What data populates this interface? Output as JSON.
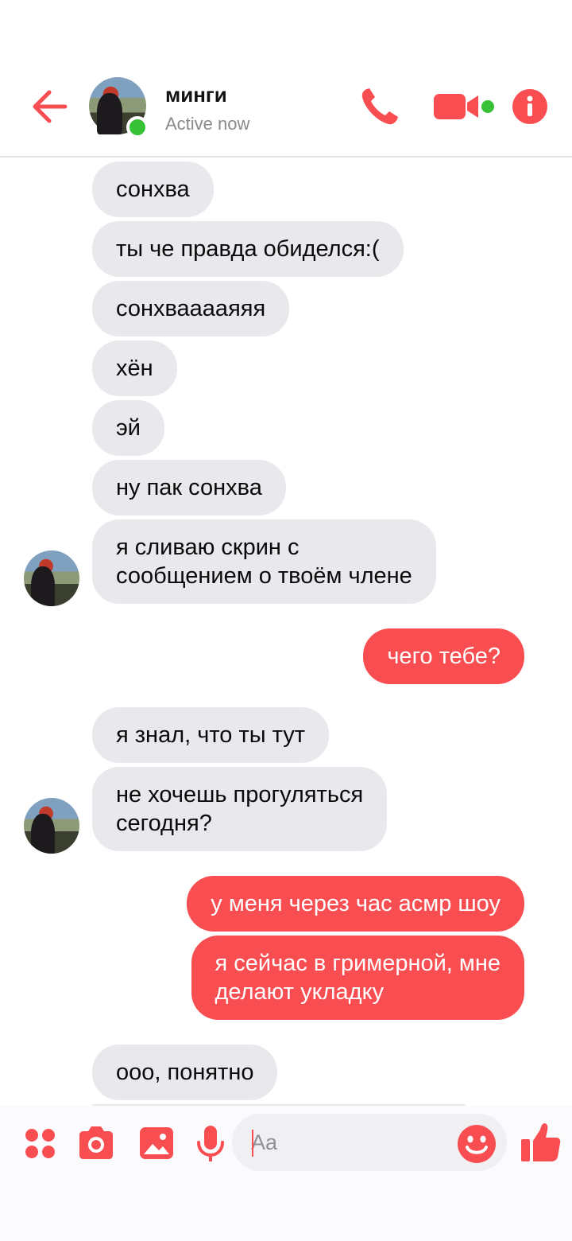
{
  "header": {
    "contact_name": "минги",
    "status": "Active now"
  },
  "messages": [
    {
      "side": "in",
      "text": "сонхва"
    },
    {
      "side": "in",
      "text": "ты че правда обиделся:("
    },
    {
      "side": "in",
      "text": "сонхвааааяяя"
    },
    {
      "side": "in",
      "text": "хён"
    },
    {
      "side": "in",
      "text": "эй"
    },
    {
      "side": "in",
      "text": "ну пак сонхва"
    },
    {
      "side": "in",
      "text": "я сливаю скрин с\nсообщением о твоём члене"
    },
    {
      "side": "out",
      "text": "чего тебе?"
    },
    {
      "side": "in",
      "text": "я знал, что ты тут"
    },
    {
      "side": "in",
      "text": "не хочешь прогуляться\nсегодня?"
    },
    {
      "side": "out",
      "text": "у меня через час асмр шоу"
    },
    {
      "side": "out",
      "text": "я сейчас в гримерной, мне\nделают укладку"
    },
    {
      "side": "in",
      "text": "ооо, понятно"
    }
  ],
  "composer": {
    "placeholder": "Aa"
  },
  "colors": {
    "accent": "#f94e51",
    "incoming_bubble": "#e9e8ec",
    "online": "#37c137"
  },
  "icons": [
    "back-arrow-icon",
    "phone-icon",
    "video-camera-icon",
    "info-icon",
    "apps-icon",
    "camera-icon",
    "photo-icon",
    "microphone-icon",
    "emoji-icon",
    "thumbs-up-icon"
  ]
}
